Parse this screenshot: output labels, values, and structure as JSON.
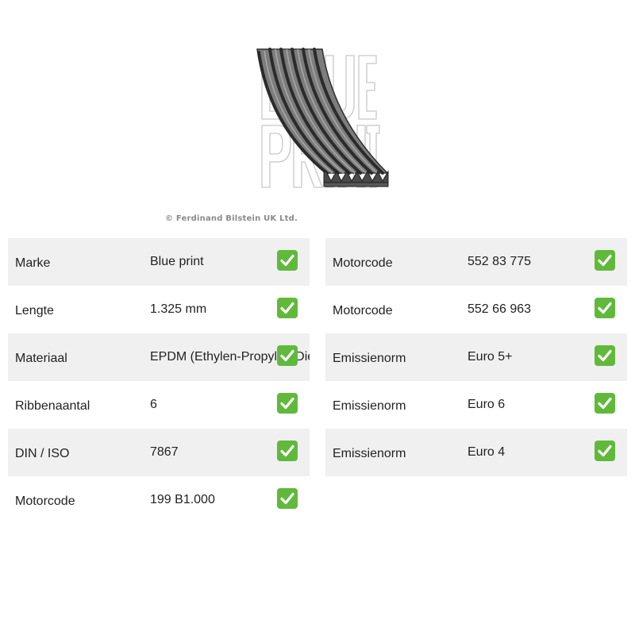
{
  "product": {
    "image_icon": "ribbed-belt-image",
    "watermark": "BLUE PRINT",
    "copyright": "© Ferdinand Bilstein UK Ltd."
  },
  "colors": {
    "row_shade": "#f0f0f0",
    "check_green": "#61b93c",
    "text": "#222222",
    "copyright": "#8a8a8a"
  },
  "specs_left": [
    {
      "label": "Marke",
      "value": "Blue print",
      "icon": "check-icon"
    },
    {
      "label": "Lengte",
      "value": "1.325 mm",
      "icon": "check-icon"
    },
    {
      "label": "Materiaal",
      "value": "EPDM (Ethylen-Propylen-Dien-Kautschuk)",
      "icon": "check-icon"
    },
    {
      "label": "Ribbenaantal",
      "value": "6",
      "icon": "check-icon"
    },
    {
      "label": "DIN / ISO",
      "value": "7867",
      "icon": "check-icon"
    },
    {
      "label": "Motorcode",
      "value": "199 B1.000",
      "icon": "check-icon"
    }
  ],
  "specs_right": [
    {
      "label": "Motorcode",
      "value": "552 83 775",
      "icon": "check-icon"
    },
    {
      "label": "Motorcode",
      "value": "552 66 963",
      "icon": "check-icon"
    },
    {
      "label": "Emissienorm",
      "value": "Euro 5+",
      "icon": "check-icon"
    },
    {
      "label": "Emissienorm",
      "value": "Euro 6",
      "icon": "check-icon"
    },
    {
      "label": "Emissienorm",
      "value": "Euro 4",
      "icon": "check-icon"
    }
  ]
}
